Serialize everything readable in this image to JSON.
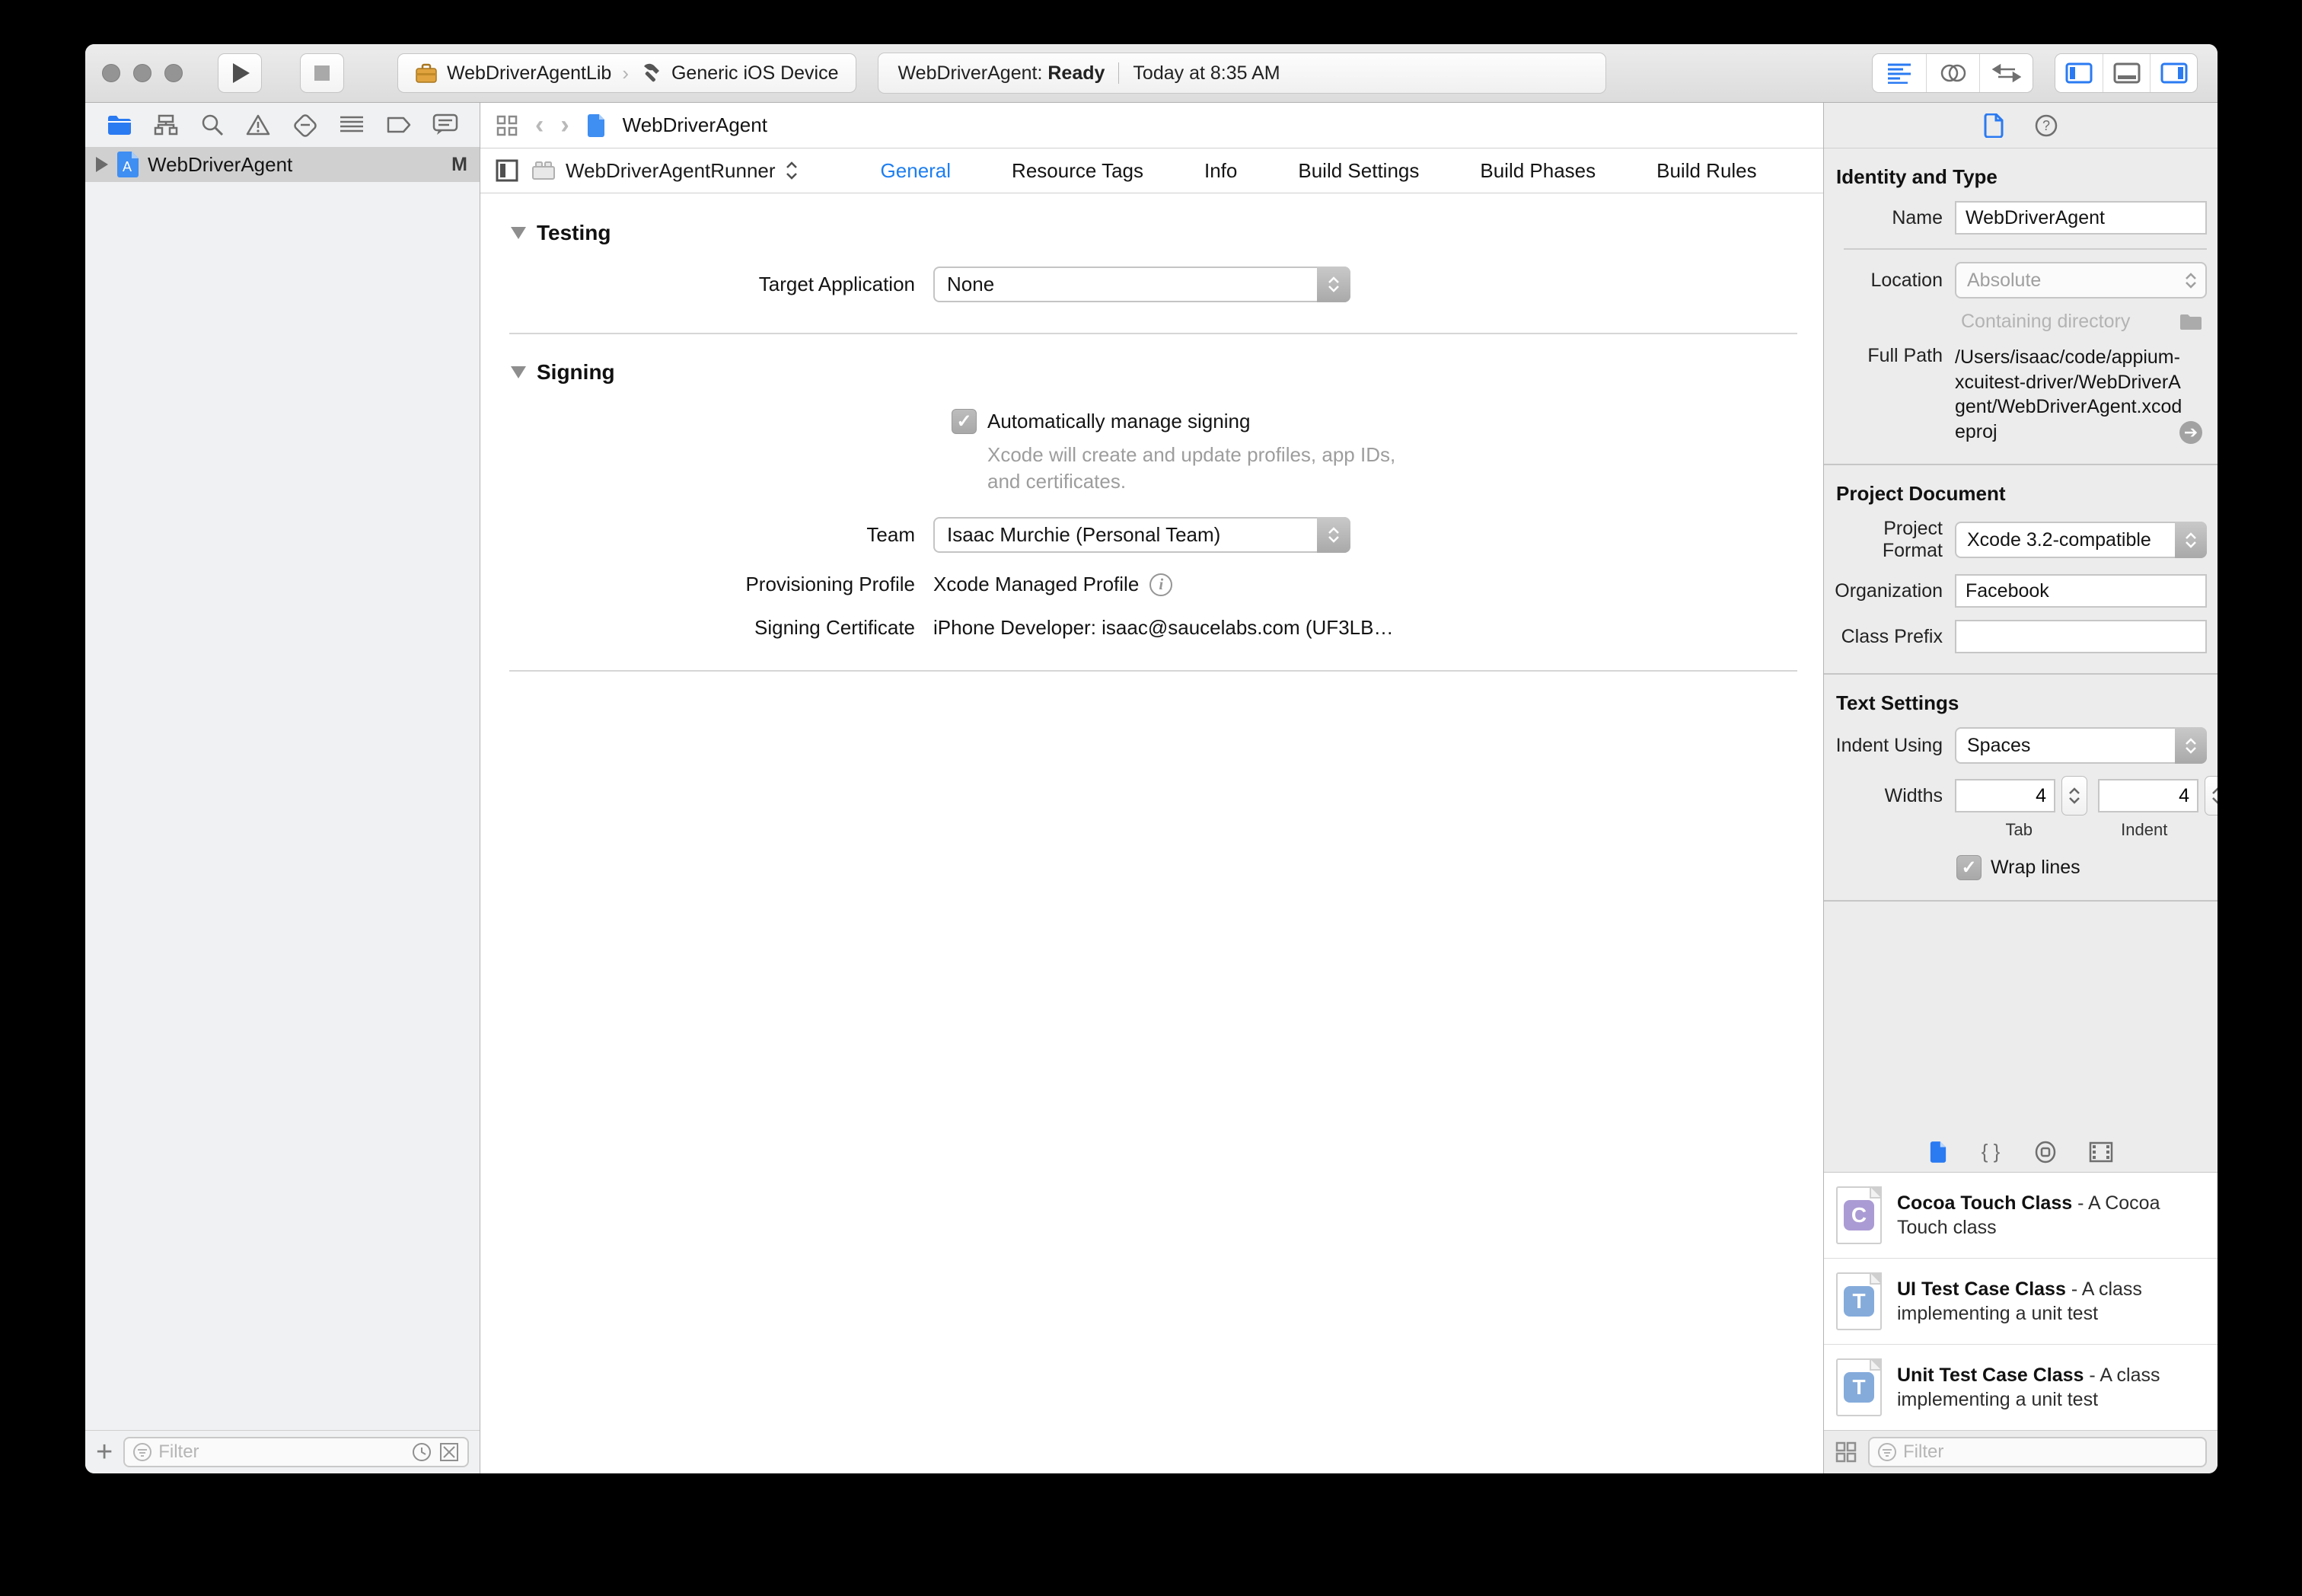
{
  "toolbar": {
    "scheme": {
      "name": "WebDriverAgentLib",
      "separator": "›",
      "destination": "Generic iOS Device"
    },
    "status": {
      "project": "WebDriverAgent:",
      "state": "Ready",
      "time": "Today at 8:35 AM"
    }
  },
  "navigator": {
    "project": {
      "name": "WebDriverAgent",
      "badge": "M"
    },
    "filter_placeholder": "Filter"
  },
  "editor": {
    "jumpbar_title": "WebDriverAgent",
    "target_selector": "WebDriverAgentRunner",
    "tabs": [
      {
        "label": "General",
        "active": true
      },
      {
        "label": "Resource Tags",
        "active": false
      },
      {
        "label": "Info",
        "active": false
      },
      {
        "label": "Build Settings",
        "active": false
      },
      {
        "label": "Build Phases",
        "active": false
      },
      {
        "label": "Build Rules",
        "active": false
      }
    ],
    "testing": {
      "title": "Testing",
      "target_application_label": "Target Application",
      "target_application_value": "None"
    },
    "signing": {
      "title": "Signing",
      "auto_manage_label": "Automatically manage signing",
      "auto_manage_checked": true,
      "auto_manage_description": "Xcode will create and update profiles, app IDs, and certificates.",
      "team_label": "Team",
      "team_value": "Isaac Murchie (Personal Team)",
      "provisioning_label": "Provisioning Profile",
      "provisioning_value": "Xcode Managed Profile",
      "certificate_label": "Signing Certificate",
      "certificate_value": "iPhone Developer: isaac@saucelabs.com (UF3LB…"
    }
  },
  "inspector": {
    "identity": {
      "heading": "Identity and Type",
      "name_label": "Name",
      "name_value": "WebDriverAgent",
      "location_label": "Location",
      "location_value": "Absolute",
      "containing_placeholder": "Containing directory",
      "fullpath_label": "Full Path",
      "fullpath_value": "/Users/isaac/code/appium-xcuitest-driver/WebDriverAgent/WebDriverAgent.xcodeproj"
    },
    "project_document": {
      "heading": "Project Document",
      "format_label": "Project Format",
      "format_value": "Xcode 3.2-compatible",
      "organization_label": "Organization",
      "organization_value": "Facebook",
      "class_prefix_label": "Class Prefix",
      "class_prefix_value": ""
    },
    "text_settings": {
      "heading": "Text Settings",
      "indent_label": "Indent Using",
      "indent_value": "Spaces",
      "widths_label": "Widths",
      "tab_width": "4",
      "indent_width": "4",
      "tab_caption": "Tab",
      "indent_caption": "Indent",
      "wrap_label": "Wrap lines",
      "wrap_checked": true
    },
    "library": {
      "items": [
        {
          "name": "Cocoa Touch Class",
          "desc": "- A Cocoa Touch class",
          "letter": "C",
          "color": "#ab9bd4"
        },
        {
          "name": "UI Test Case Class",
          "desc": "- A class implementing a unit test",
          "letter": "T",
          "color": "#85abdb"
        },
        {
          "name": "Unit Test Case Class",
          "desc": "- A class implementing a unit test",
          "letter": "T",
          "color": "#85abdb"
        }
      ],
      "filter_placeholder": "Filter"
    }
  },
  "colors": {
    "accent_blue": "#1d7ef0",
    "selection_gray": "#d0d0d0",
    "check": "✓"
  }
}
